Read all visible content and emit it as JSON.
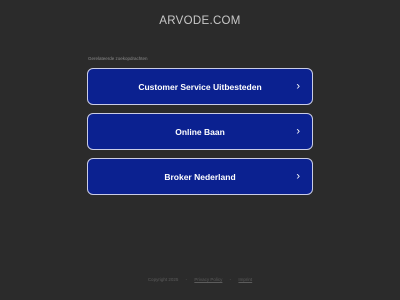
{
  "header": {
    "title": "ARVODE.COM"
  },
  "related": {
    "label": "Gerelateerde zoekopdrachten",
    "items": [
      {
        "label": "Customer Service Uitbesteden",
        "icon": "chevron-right-icon"
      },
      {
        "label": "Online Baan",
        "icon": "chevron-right-icon"
      },
      {
        "label": "Broker Nederland",
        "icon": "chevron-right-icon"
      }
    ]
  },
  "footer": {
    "copyright": "Copyright 2025",
    "separator": "-",
    "privacy_policy": "Privacy Policy",
    "imprint": "Imprint"
  },
  "colors": {
    "background": "#2b2b2b",
    "button_background": "#0b2190",
    "button_border": "#c9cce6",
    "button_text": "#ffffff"
  }
}
